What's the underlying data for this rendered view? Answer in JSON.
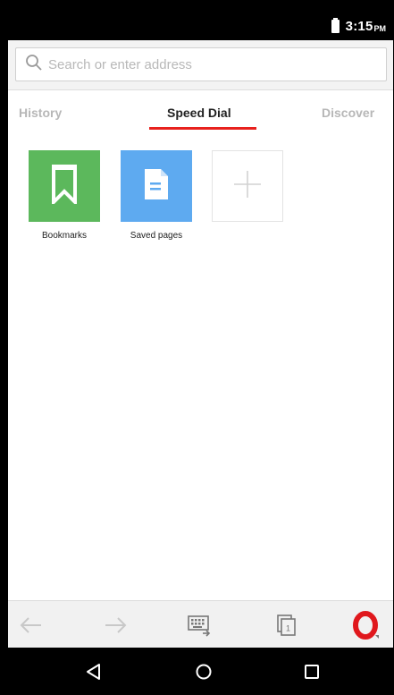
{
  "status_bar": {
    "time": "3:15",
    "ampm": "PM"
  },
  "address_bar": {
    "placeholder": "Search or enter address",
    "value": ""
  },
  "tabs": [
    {
      "label": "History",
      "active": false
    },
    {
      "label": "Speed Dial",
      "active": true
    },
    {
      "label": "Discover",
      "active": false
    }
  ],
  "speed_dial": [
    {
      "label": "Bookmarks",
      "icon": "bookmark-icon",
      "color": "#5cb85c"
    },
    {
      "label": "Saved pages",
      "icon": "document-icon",
      "color": "#5eaaf0"
    },
    {
      "label": "",
      "icon": "plus-icon",
      "color": "#ffffff"
    }
  ],
  "toolbar": {
    "items": [
      "back-arrow-icon",
      "forward-arrow-icon",
      "keyboard-icon",
      "tabs-icon",
      "opera-logo-icon"
    ],
    "tab_count": "1"
  },
  "nav_bar": {
    "items": [
      "back-icon",
      "home-icon",
      "recents-icon"
    ]
  },
  "colors": {
    "accent": "#e8211d",
    "opera_red": "#e0181d"
  }
}
